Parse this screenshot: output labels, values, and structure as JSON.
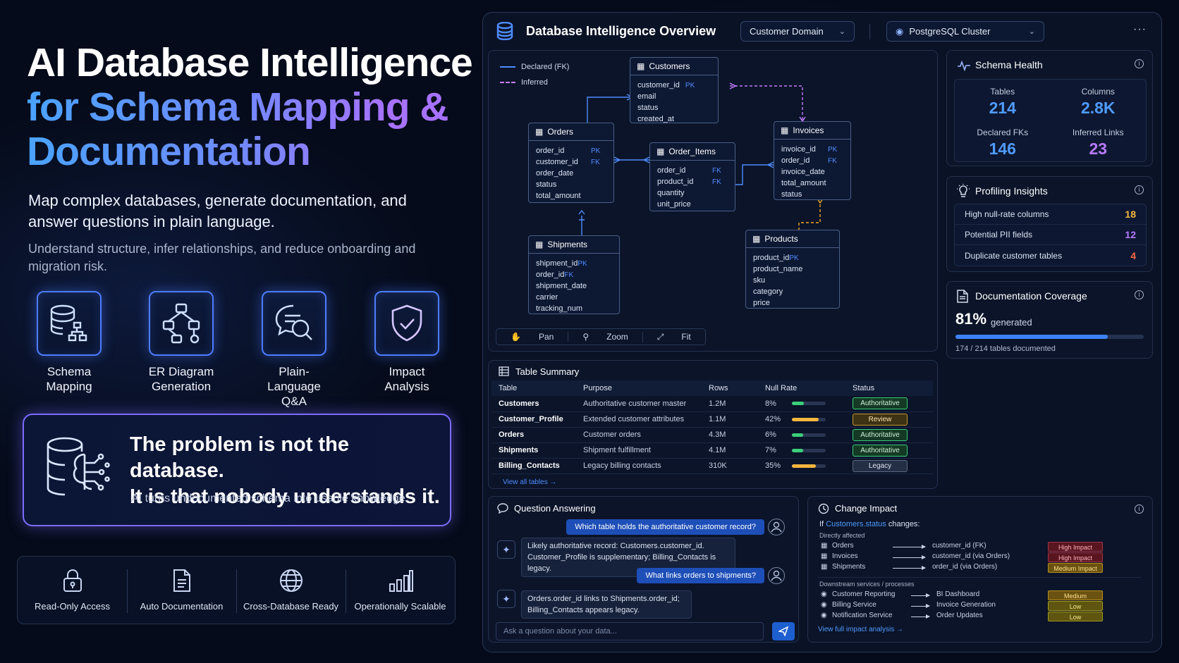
{
  "hero": {
    "title_line1": "AI Database Intelligence",
    "title_line2": "for Schema Mapping &",
    "title_line3": "Documentation",
    "subtitle": "Map complex databases, generate documentation, and answer questions in plain language.",
    "subtitle2": "Understand structure, infer relationships, and reduce onboarding and migration risk."
  },
  "features": [
    {
      "label_line1": "Schema",
      "label_line2": "Mapping",
      "icon": "database-schema-icon"
    },
    {
      "label_line1": "ER Diagram",
      "label_line2": "Generation",
      "icon": "diagram-icon"
    },
    {
      "label_line1": "Plain-Language",
      "label_line2": "Q&A",
      "icon": "chat-search-icon"
    },
    {
      "label_line1": "Impact",
      "label_line2": "Analysis",
      "icon": "shield-check-icon"
    }
  ],
  "problem": {
    "line1": "The problem is not the database.",
    "line2": "It is that nobody understands it.",
    "caption": "AI turns undocumented schema into usable knowledge."
  },
  "bottom_features": [
    {
      "label": "Read-Only Access",
      "icon": "lock-icon"
    },
    {
      "label": "Auto Documentation",
      "icon": "document-icon"
    },
    {
      "label": "Cross-Database Ready",
      "icon": "globe-icon"
    },
    {
      "label": "Operationally Scalable",
      "icon": "bar-chart-icon"
    }
  ],
  "panel": {
    "title": "Database Intelligence Overview",
    "domain_select": "Customer Domain",
    "cluster_select": "PostgreSQL Cluster",
    "more": "···"
  },
  "er": {
    "legend_declared": "Declared (FK)",
    "legend_inferred": "Inferred",
    "tools": {
      "pan": "Pan",
      "zoom": "Zoom",
      "fit": "Fit"
    },
    "tables": {
      "customers": {
        "name": "Customers",
        "cols": [
          [
            "customer_id",
            "PK"
          ],
          [
            "email",
            ""
          ],
          [
            "status",
            ""
          ],
          [
            "created_at",
            ""
          ]
        ]
      },
      "orders": {
        "name": "Orders",
        "cols": [
          [
            "order_id",
            "PK"
          ],
          [
            "customer_id",
            "FK"
          ],
          [
            "order_date",
            ""
          ],
          [
            "status",
            ""
          ],
          [
            "total_amount",
            ""
          ]
        ]
      },
      "order_items": {
        "name": "Order_Items",
        "cols": [
          [
            "order_id",
            "FK"
          ],
          [
            "product_id",
            "FK"
          ],
          [
            "quantity",
            ""
          ],
          [
            "unit_price",
            ""
          ]
        ]
      },
      "invoices": {
        "name": "Invoices",
        "cols": [
          [
            "invoice_id",
            "PK"
          ],
          [
            "order_id",
            "FK"
          ],
          [
            "invoice_date",
            ""
          ],
          [
            "total_amount",
            ""
          ],
          [
            "status",
            ""
          ]
        ]
      },
      "shipments": {
        "name": "Shipments",
        "cols": [
          [
            "shipment_id",
            "PK"
          ],
          [
            "order_id",
            "FK"
          ],
          [
            "shipment_date",
            ""
          ],
          [
            "carrier",
            ""
          ],
          [
            "tracking_num",
            ""
          ]
        ]
      },
      "products": {
        "name": "Products",
        "cols": [
          [
            "product_id",
            "PK"
          ],
          [
            "product_name",
            ""
          ],
          [
            "sku",
            ""
          ],
          [
            "category",
            ""
          ],
          [
            "price",
            ""
          ]
        ]
      }
    }
  },
  "schema_health": {
    "title": "Schema Health",
    "stats": [
      {
        "label": "Tables",
        "value": "214",
        "color": "#4f9bff"
      },
      {
        "label": "Columns",
        "value": "2.8K",
        "color": "#4f9bff"
      },
      {
        "label": "Declared FKs",
        "value": "146",
        "color": "#4f9bff"
      },
      {
        "label": "Inferred Links",
        "value": "23",
        "color": "#b67bff"
      }
    ]
  },
  "profiling": {
    "title": "Profiling Insights",
    "items": [
      {
        "label": "High null-rate columns",
        "value": "18",
        "color": "#f5b63d"
      },
      {
        "label": "Potential PII fields",
        "value": "12",
        "color": "#b67bff"
      },
      {
        "label": "Duplicate customer tables",
        "value": "4",
        "color": "#ff6a4a"
      }
    ]
  },
  "doc_coverage": {
    "title": "Documentation Coverage",
    "percent": "81%",
    "percent_value": 0.81,
    "suffix": "generated",
    "footer": "174 / 214 tables documented"
  },
  "table_summary": {
    "title": "Table Summary",
    "headers": [
      "Table",
      "Purpose",
      "Rows",
      "Null Rate",
      "Status"
    ],
    "rows": [
      {
        "table": "Customers",
        "purpose": "Authoritative customer master",
        "rows": "1.2M",
        "null": "8%",
        "null_value": 0.08,
        "bar_color": "#3ad07a",
        "status": "Authoritative",
        "status_kind": "auth"
      },
      {
        "table": "Customer_Profile",
        "purpose": "Extended customer attributes",
        "rows": "1.1M",
        "null": "42%",
        "null_value": 0.42,
        "bar_color": "#f5b63d",
        "status": "Review",
        "status_kind": "review"
      },
      {
        "table": "Orders",
        "purpose": "Customer orders",
        "rows": "4.3M",
        "null": "6%",
        "null_value": 0.06,
        "bar_color": "#3ad07a",
        "status": "Authoritative",
        "status_kind": "auth"
      },
      {
        "table": "Shipments",
        "purpose": "Shipment fulfillment",
        "rows": "4.1M",
        "null": "7%",
        "null_value": 0.07,
        "bar_color": "#3ad07a",
        "status": "Authoritative",
        "status_kind": "auth"
      },
      {
        "table": "Billing_Contacts",
        "purpose": "Legacy billing contacts",
        "rows": "310K",
        "null": "35%",
        "null_value": 0.35,
        "bar_color": "#f5b63d",
        "status": "Legacy",
        "status_kind": "legacy"
      }
    ],
    "view_all": "View all tables →"
  },
  "qa": {
    "title": "Question Answering",
    "q1": "Which table holds the authoritative customer record?",
    "a1_line1": "Likely authoritative record: Customers.customer_id.",
    "a1_line2": "Customer_Profile is supplementary; Billing_Contacts is legacy.",
    "q2": "What links orders to shipments?",
    "a2_line1": "Orders.order_id links to Shipments.order_id;",
    "a2_line2": "Billing_Contacts appears legacy.",
    "placeholder": "Ask a question about your data..."
  },
  "change_impact": {
    "title": "Change Impact",
    "if_prefix": "If",
    "if_field": "Customers.status",
    "if_suffix": "changes:",
    "directly_affected": "Directly affected",
    "direct": [
      {
        "table": "Orders",
        "target": "customer_id (FK)",
        "impact": "High Impact",
        "kind": "high"
      },
      {
        "table": "Invoices",
        "target": "customer_id (via Orders)",
        "impact": "High Impact",
        "kind": "high"
      },
      {
        "table": "Shipments",
        "target": "order_id (via Orders)",
        "impact": "Medium Impact",
        "kind": "medium"
      }
    ],
    "downstream_label": "Downstream services / processes",
    "downstream": [
      {
        "service": "Customer Reporting",
        "target": "BI Dashboard",
        "impact": "Medium",
        "kind": "medium"
      },
      {
        "service": "Billing Service",
        "target": "Invoice Generation",
        "impact": "Low",
        "kind": "low"
      },
      {
        "service": "Notification Service",
        "target": "Order Updates",
        "impact": "Low",
        "kind": "low"
      }
    ],
    "view_full": "View full impact analysis →"
  }
}
